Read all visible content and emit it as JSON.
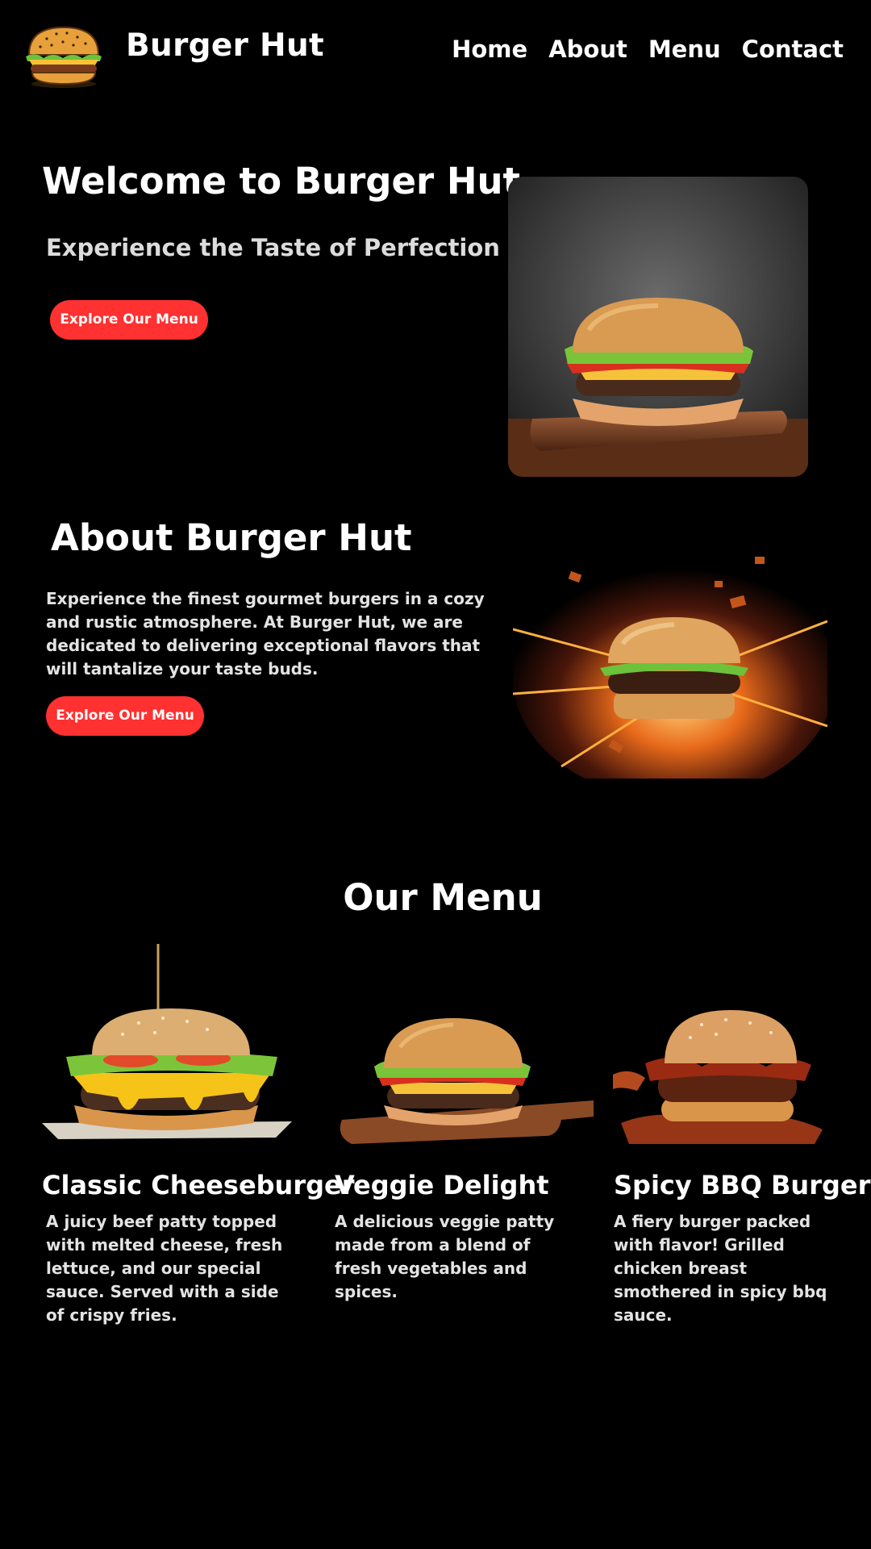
{
  "header": {
    "brand": "Burger Hut",
    "nav": [
      "Home",
      "About",
      "Menu",
      "Contact"
    ]
  },
  "hero": {
    "title": "Welcome to Burger Hut",
    "subtitle": "Experience the Taste of Perfection",
    "button": "Explore Our Menu"
  },
  "about": {
    "title": "About Burger Hut",
    "text": "Experience the finest gourmet burgers in a cozy and rustic atmosphere. At Burger Hut, we are dedicated to delivering exceptional flavors that will tantalize your taste buds.",
    "button": "Explore Our Menu"
  },
  "menu": {
    "title": "Our Menu",
    "items": [
      {
        "name": "Classic Cheeseburger",
        "desc": "A juicy beef patty topped with melted cheese, fresh lettuce, and our special sauce. Served with a side of crispy fries."
      },
      {
        "name": "Veggie Delight",
        "desc": "A delicious veggie patty made from a blend of fresh vegetables and spices."
      },
      {
        "name": "Spicy BBQ Burger",
        "desc": "A fiery burger packed with flavor! Grilled chicken breast smothered in spicy bbq sauce."
      }
    ]
  },
  "colors": {
    "background": "#000000",
    "button": "#ff3131",
    "text": "#ffffff"
  }
}
